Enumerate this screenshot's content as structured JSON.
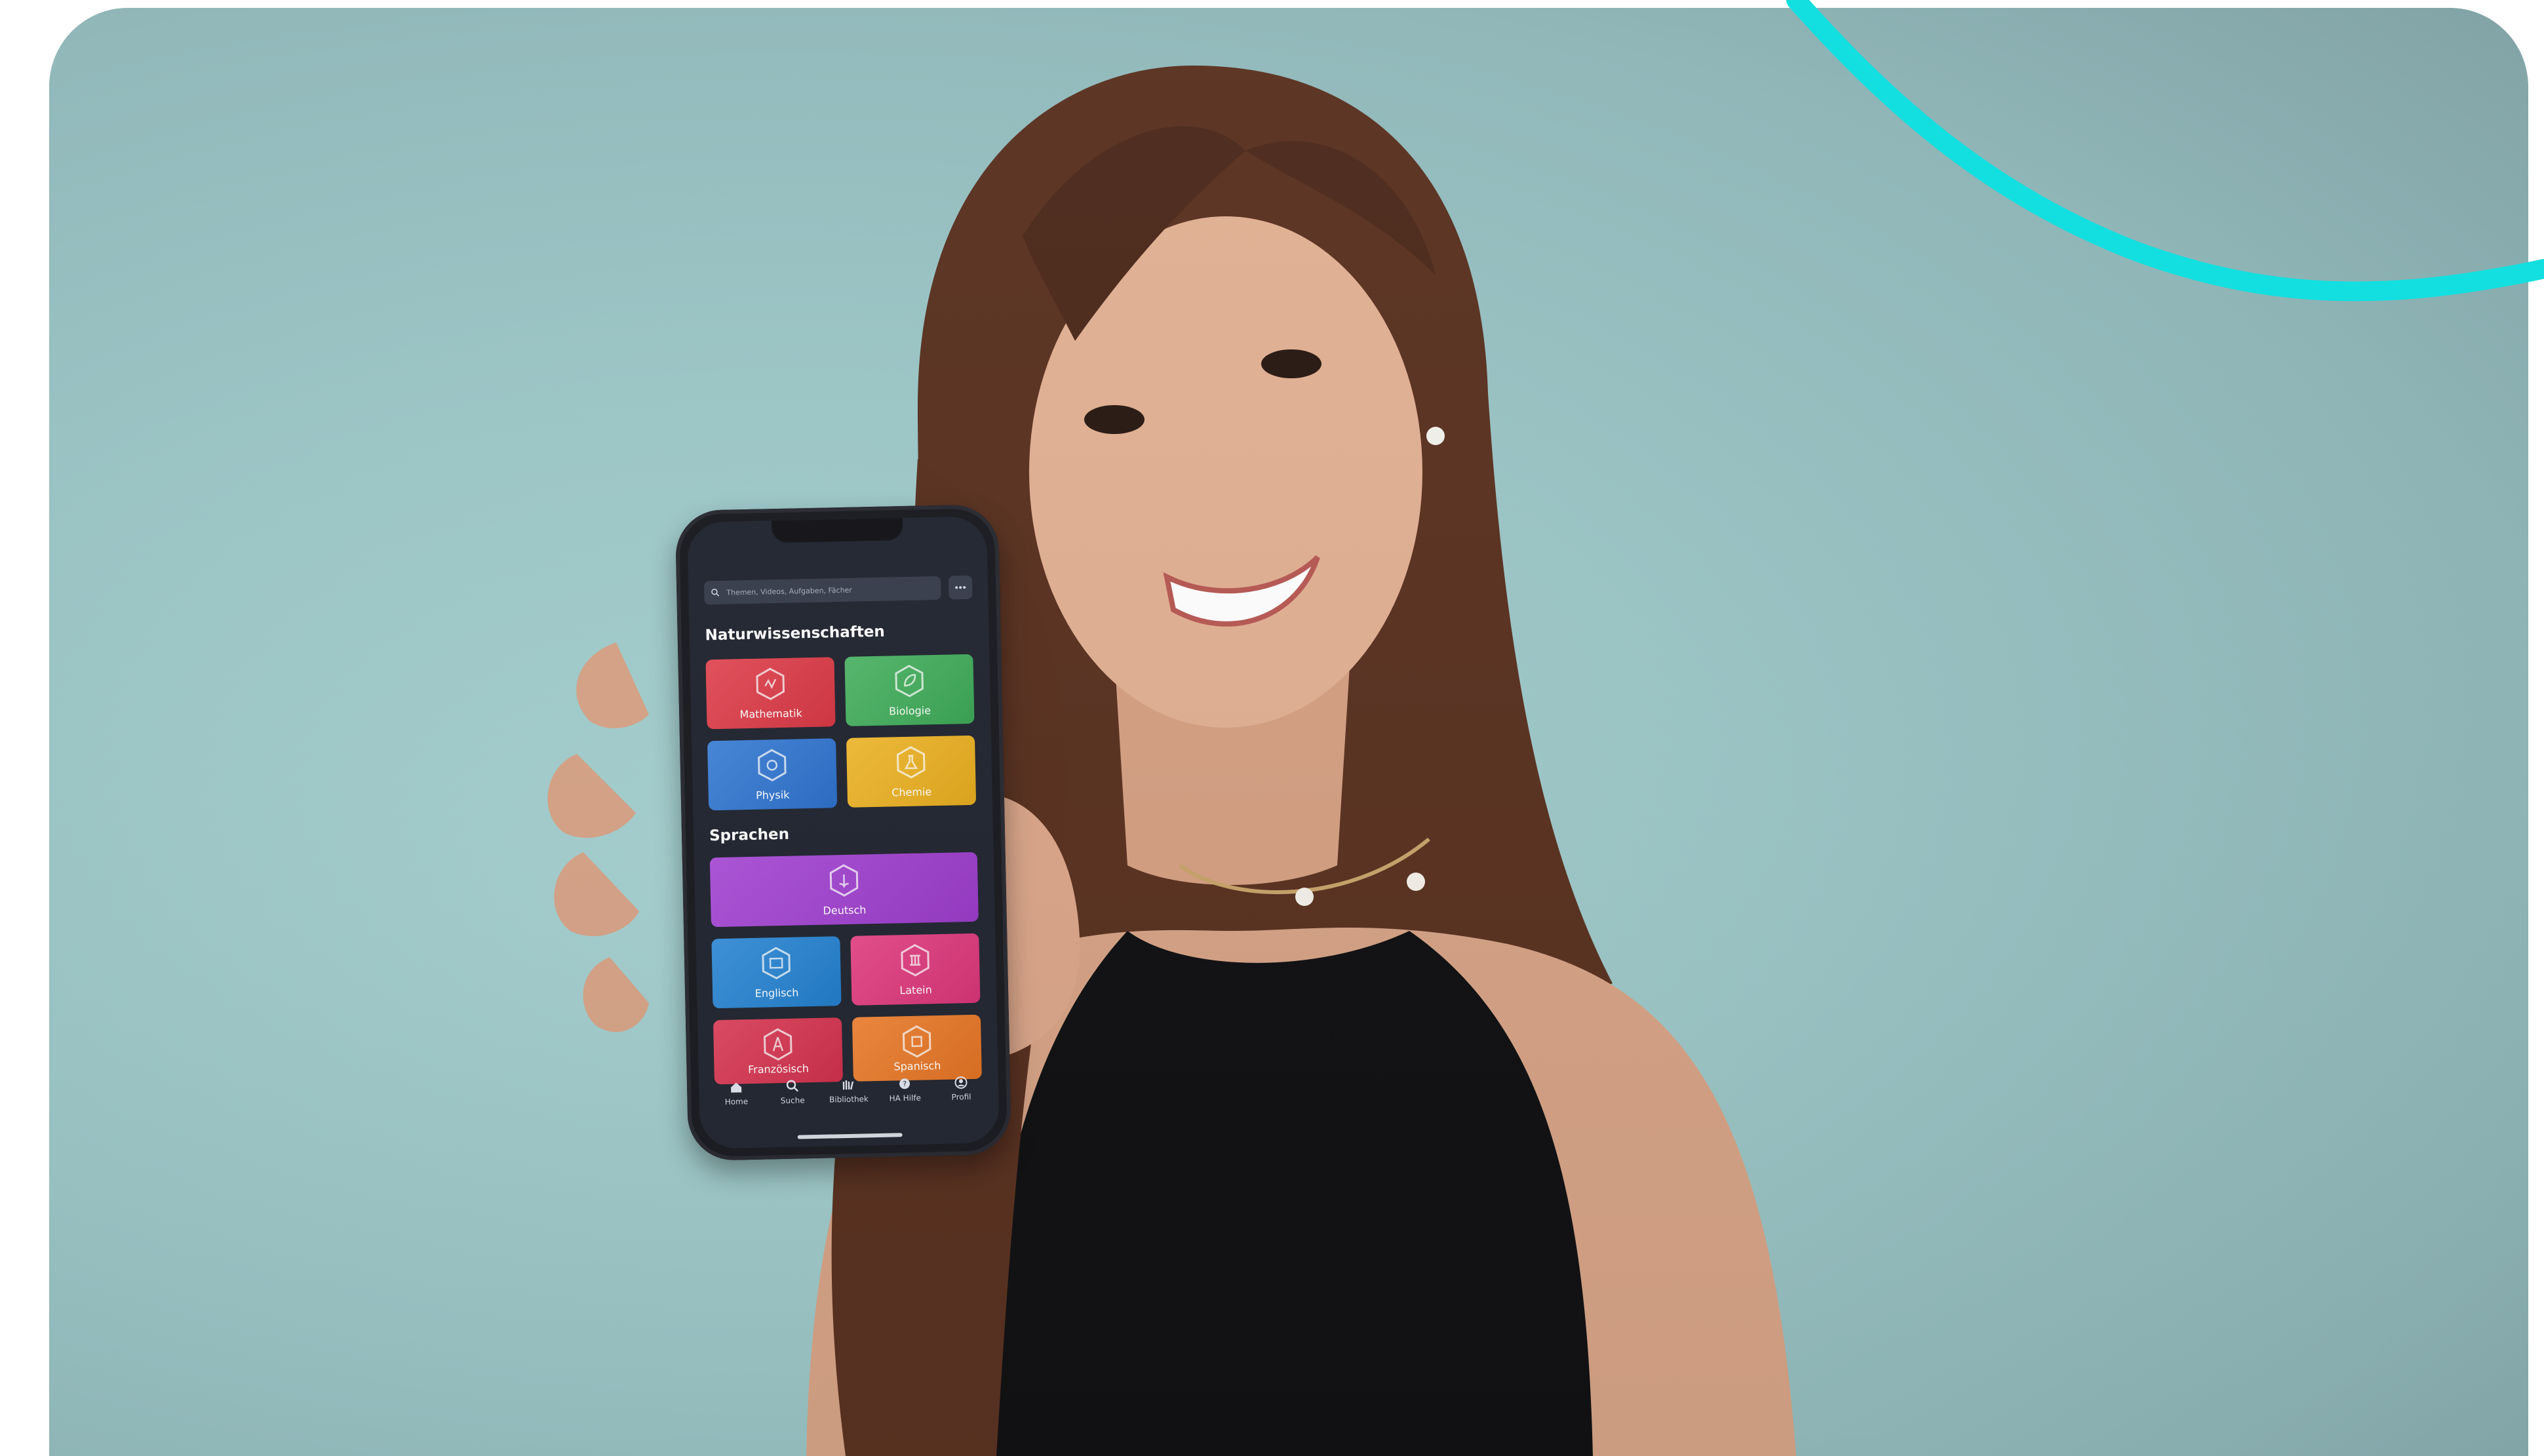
{
  "colors": {
    "accent_curve": "#13dfe0",
    "photo_bg": "#9dc7c8",
    "screen_bg": "#242833"
  },
  "app": {
    "search": {
      "placeholder": "Themen, Videos, Aufgaben, Fächer",
      "icon": "search-icon",
      "more_icon": "more-icon"
    },
    "sections": [
      {
        "title": "Naturwissenschaften",
        "subjects": [
          {
            "label": "Mathematik",
            "color": "#e23a47",
            "icon": "math-icon"
          },
          {
            "label": "Biologie",
            "color": "#3fb05a",
            "icon": "leaf-icon"
          },
          {
            "label": "Physik",
            "color": "#2f77d6",
            "icon": "atom-icon"
          },
          {
            "label": "Chemie",
            "color": "#f2b51f",
            "icon": "flask-icon"
          }
        ]
      },
      {
        "title": "Sprachen",
        "subjects": [
          {
            "label": "Deutsch",
            "color": "#a43fd6",
            "icon": "book-icon"
          },
          {
            "label": "Englisch",
            "color": "#2486d8",
            "icon": "flag-icon"
          },
          {
            "label": "Latein",
            "color": "#e5377e",
            "icon": "column-icon"
          },
          {
            "label": "Französisch",
            "color": "#dd3350",
            "icon": "tower-icon"
          },
          {
            "label": "Spanisch",
            "color": "#f07a25",
            "icon": "fan-icon"
          }
        ]
      }
    ],
    "tabbar": [
      {
        "label": "Home",
        "icon": "home-icon"
      },
      {
        "label": "Suche",
        "icon": "search-icon"
      },
      {
        "label": "Bibliothek",
        "icon": "library-icon"
      },
      {
        "label": "HA Hilfe",
        "icon": "help-icon"
      },
      {
        "label": "Profil",
        "icon": "profile-icon"
      }
    ]
  }
}
